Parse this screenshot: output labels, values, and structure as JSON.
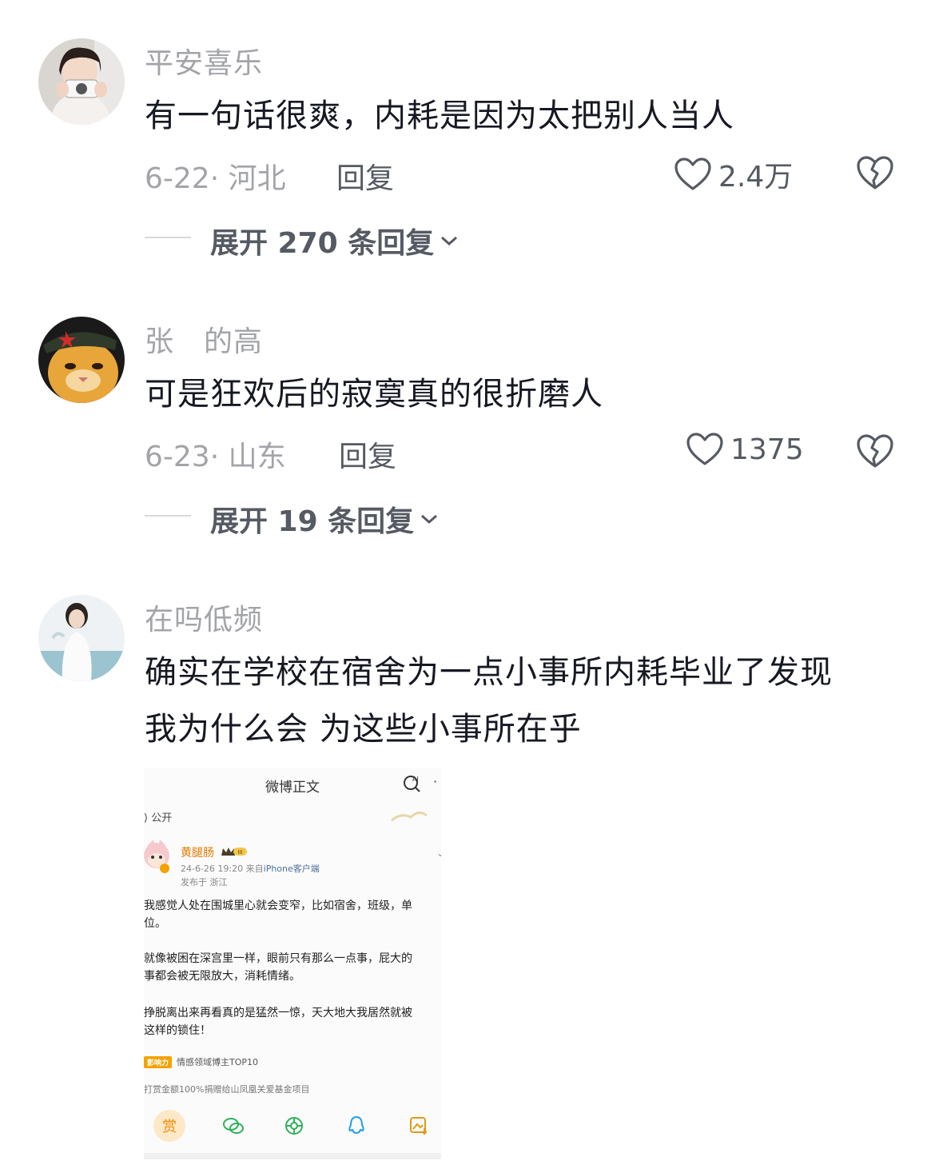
{
  "comments": [
    {
      "username": "平安喜乐",
      "text_lines": [
        "有一句话很爽，内耗是因为太把别人当人"
      ],
      "date": "6-22",
      "sep": "·",
      "location": "河北",
      "reply_label": "回复",
      "likes": "2.4万",
      "expand_label": "展开 270 条回复"
    },
    {
      "username": "张　的高",
      "text_lines": [
        "可是狂欢后的寂寞真的很折磨人"
      ],
      "date": "6-23",
      "sep": "·",
      "location": "山东",
      "reply_label": "回复",
      "likes": "1375",
      "expand_label": "展开 19 条回复"
    },
    {
      "username": "在吗低频",
      "text_lines": [
        "确实在学校在宿舍为一点小事所内耗毕业了发现",
        "我为什么会 为这些小事所在乎"
      ]
    }
  ],
  "embedded_post": {
    "title": "微博正文",
    "dot": "·",
    "visibility": "公开",
    "author": "黄腿肠",
    "badge": "III",
    "time": "24-6-26 19:20",
    "source_prefix": "来自",
    "source": "iPhone客户端",
    "location": "发布于 浙江",
    "body_lines": [
      "我感觉人处在围城里心就会变窄，比如宿舍，班级，单",
      "位。",
      "",
      "就像被困在深宫里一样，眼前只有那么一点事，屁大的",
      "事都会被无限放大，消耗情绪。",
      "",
      "挣脱离出来再看真的是猛然一惊，天大地大我居然就被",
      "这样的锁住！"
    ],
    "influence_tag": "影响力",
    "tag_text": "情感领域博主TOP10",
    "donate_text": "打赏金额100%捐赠给山凤凰关爱基金项目",
    "reward_label": "赏"
  },
  "colors": {
    "username": "#a2a4a8",
    "text": "#161823",
    "secondary": "#555a63"
  },
  "icons": [
    "heart-outline-icon",
    "broken-heart-icon",
    "chevron-down-icon",
    "ai-search-icon",
    "wechat-icon",
    "moments-icon",
    "qq-icon",
    "save-image-icon"
  ]
}
